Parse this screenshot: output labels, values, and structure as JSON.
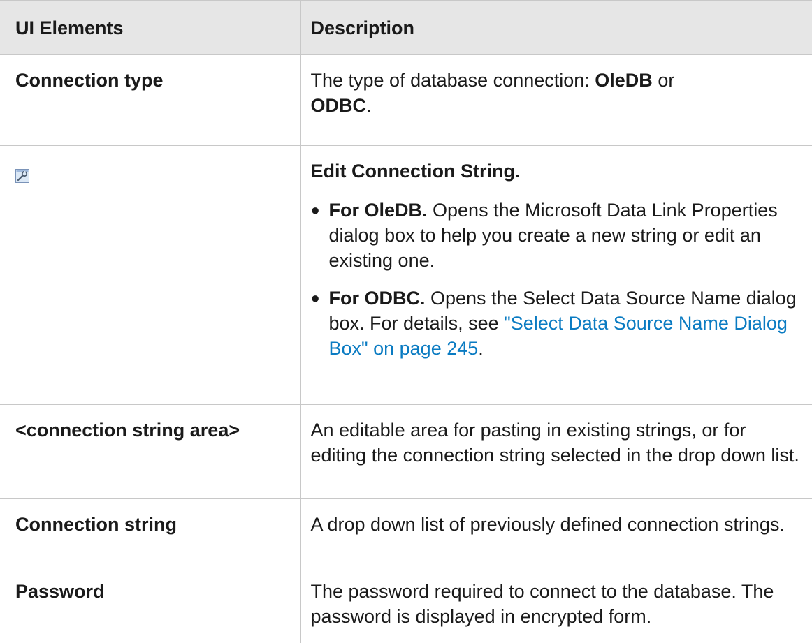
{
  "table": {
    "headers": [
      "UI Elements",
      "Description"
    ],
    "rows": {
      "connection_type": {
        "element": "Connection type",
        "desc_prefix": "The type of database connection: ",
        "desc_kw1": "OleDB",
        "desc_mid": " or ",
        "desc_kw2": "ODBC",
        "desc_suffix": "."
      },
      "edit_icon_row": {
        "icon": "edit-connection-string-icon",
        "title": "Edit Connection String.",
        "bullets": [
          {
            "lead": "For OleDB.",
            "text": " Opens the Microsoft Data Link Properties dialog box to help you create a new string or edit an existing one."
          },
          {
            "lead": "For ODBC.",
            "text": " Opens the Select Data Source Name dialog box. For details, see ",
            "link": "\"Select Data Source Name Dialog Box\" on page 245",
            "after": "."
          }
        ]
      },
      "connection_string_area": {
        "element": "<connection string area>",
        "desc": "An editable area for pasting in existing strings, or for editing the connection string selected in the drop down list."
      },
      "connection_string": {
        "element": "Connection string",
        "desc": "A drop down list of previously defined connection strings."
      },
      "password": {
        "element": "Password",
        "desc": "The password required to connect to the database. The password is displayed in encrypted form."
      }
    }
  },
  "colors": {
    "header_bg": "#e6e6e6",
    "border": "#c8c8c8",
    "link": "#0a7bc2"
  }
}
